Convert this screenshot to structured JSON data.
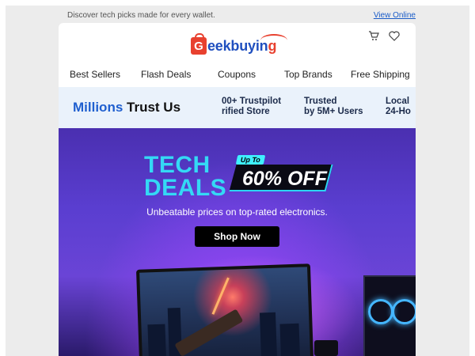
{
  "preheader": {
    "text": "Discover tech picks made for every wallet.",
    "view_online": "View Online"
  },
  "header": {
    "logo_letter": "G",
    "logo_text_blue": "eekbuyin",
    "logo_text_end": "g",
    "icons": [
      "cart-icon",
      "heart-icon"
    ]
  },
  "nav": [
    "Best Sellers",
    "Flash Deals",
    "Coupons",
    "Top Brands",
    "Free Shipping"
  ],
  "trust": {
    "millions_blue": "Millions",
    "millions_rest": " Trust Us",
    "items": [
      [
        "00+ Trustpilot",
        "rified Store"
      ],
      [
        "Trusted",
        "by 5M+ Users"
      ],
      [
        "Local ",
        "24-Ho"
      ]
    ]
  },
  "hero": {
    "tech": "TECH",
    "deals": "DEALS",
    "up_to": "Up To",
    "off": "60% OFF",
    "subtitle": "Unbeatable prices on top-rated electronics.",
    "button": "Shop Now"
  },
  "colors": {
    "accent_blue": "#1f5fcf",
    "brand_red": "#e8412f",
    "hero_cyan": "#34d9f5"
  }
}
